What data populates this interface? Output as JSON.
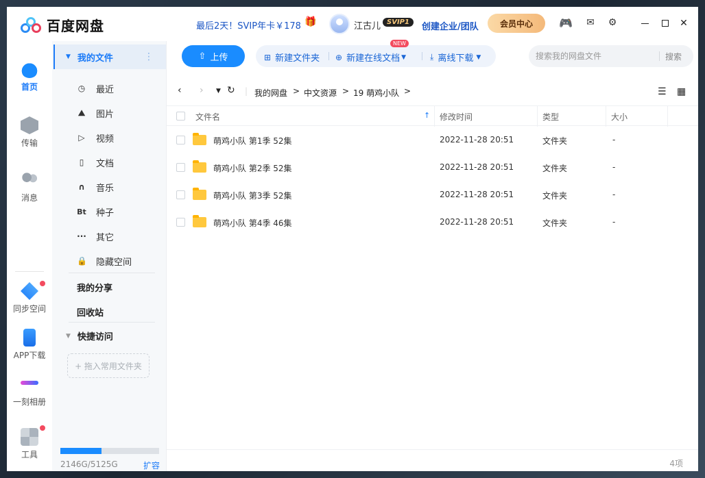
{
  "app": {
    "name": "百度网盘"
  },
  "header": {
    "promo": "最后2天！SVIP年卡￥178",
    "username": "江古儿",
    "vip_badge": "SVIP1",
    "enterprise": "创建企业/团队",
    "member_center": "会员中心"
  },
  "leftnav": {
    "home": "首页",
    "transfer": "传输",
    "message": "消息",
    "sync": "同步空间",
    "app_download": "APP下载",
    "moment_album": "一刻相册",
    "tools": "工具"
  },
  "sidebar": {
    "my_files": "我的文件",
    "items": [
      {
        "label": "最近",
        "icon": "clock-icon"
      },
      {
        "label": "图片",
        "icon": "image-icon"
      },
      {
        "label": "视频",
        "icon": "play-icon"
      },
      {
        "label": "文档",
        "icon": "document-icon"
      },
      {
        "label": "音乐",
        "icon": "headphones-icon"
      },
      {
        "label": "种子",
        "icon": "bt-icon"
      },
      {
        "label": "其它",
        "icon": "more-icon"
      },
      {
        "label": "隐藏空间",
        "icon": "lock-icon"
      }
    ],
    "my_share": "我的分享",
    "recycle_bin": "回收站",
    "quick_access": "快捷访问",
    "drop_hint": "+ 拖入常用文件夹",
    "storage_text": "2146G/5125G",
    "storage_used_fraction": 0.419,
    "expand": "扩容"
  },
  "toolbar": {
    "upload": "上传",
    "new_folder": "新建文件夹",
    "new_online_doc": "新建在线文档",
    "new_badge": "NEW",
    "offline_download": "离线下载",
    "search_placeholder": "搜索我的网盘文件",
    "search_button": "搜索"
  },
  "breadcrumb": [
    "我的网盘",
    "中文资源",
    "19 萌鸡小队"
  ],
  "table": {
    "columns": [
      "文件名",
      "修改时间",
      "类型",
      "大小"
    ],
    "rows": [
      {
        "name": "萌鸡小队 第1季 52集",
        "modified": "2022-11-28 20:51",
        "type": "文件夹",
        "size": "-"
      },
      {
        "name": "萌鸡小队 第2季 52集",
        "modified": "2022-11-28 20:51",
        "type": "文件夹",
        "size": "-"
      },
      {
        "name": "萌鸡小队 第3季 52集",
        "modified": "2022-11-28 20:51",
        "type": "文件夹",
        "size": "-"
      },
      {
        "name": "萌鸡小队 第4季 46集",
        "modified": "2022-11-28 20:51",
        "type": "文件夹",
        "size": "-"
      }
    ]
  },
  "status": {
    "count": "4项"
  },
  "colors": {
    "accent": "#1a8cff",
    "link": "#1a55c4",
    "folder": "#ffc83d",
    "badge": "#f34b5f"
  }
}
